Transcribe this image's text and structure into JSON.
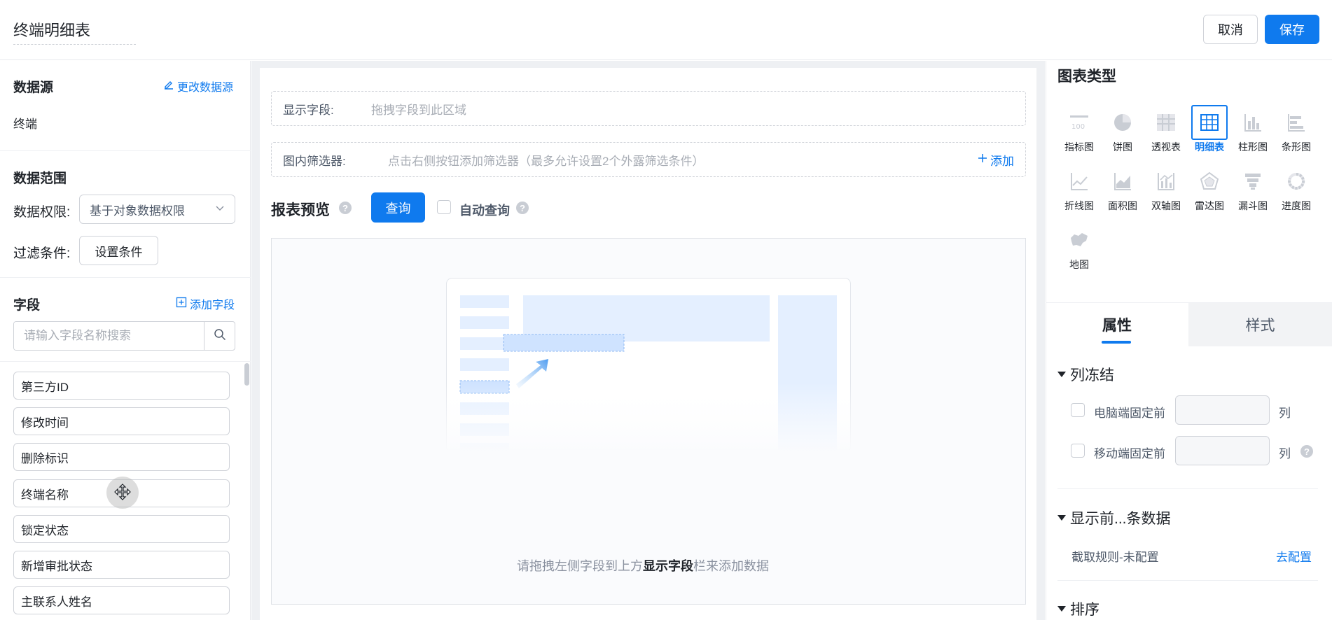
{
  "header": {
    "title": "终端明细表",
    "cancel_label": "取消",
    "save_label": "保存"
  },
  "left": {
    "datasource": {
      "title": "数据源",
      "change_link": "更改数据源",
      "value": "终端"
    },
    "data_range": {
      "title": "数据范围",
      "permission_label": "数据权限:",
      "permission_value": "基于对象数据权限",
      "filter_label": "过滤条件:",
      "filter_button": "设置条件"
    },
    "fields": {
      "title": "字段",
      "add_link": "添加字段",
      "search_placeholder": "请输入字段名称搜索",
      "items": [
        "第三方ID",
        "修改时间",
        "删除标识",
        "终端名称",
        "锁定状态",
        "新增审批状态",
        "主联系人姓名"
      ]
    }
  },
  "center": {
    "display_fields_label": "显示字段:",
    "display_fields_hint": "拖拽字段到此区域",
    "filter_label": "图内筛选器:",
    "filter_hint": "点击右侧按钮添加筛选器（最多允许设置2个外露筛选条件）",
    "filter_add": "添加",
    "preview_title": "报表预览",
    "query_button": "查询",
    "auto_query_label": "自动查询",
    "empty_hint_prefix": "请拖拽左侧字段到上方",
    "empty_hint_bold": "显示字段",
    "empty_hint_suffix": "栏来添加数据"
  },
  "right": {
    "chart_type_title": "图表类型",
    "chart_types": [
      {
        "label": "指标图",
        "icon": "metric-chart-icon"
      },
      {
        "label": "饼图",
        "icon": "pie-chart-icon"
      },
      {
        "label": "透视表",
        "icon": "pivot-table-icon"
      },
      {
        "label": "明细表",
        "icon": "detail-table-icon",
        "active": true
      },
      {
        "label": "柱形图",
        "icon": "column-chart-icon"
      },
      {
        "label": "条形图",
        "icon": "bar-chart-icon"
      },
      {
        "label": "折线图",
        "icon": "line-chart-icon"
      },
      {
        "label": "面积图",
        "icon": "area-chart-icon"
      },
      {
        "label": "双轴图",
        "icon": "dual-axis-chart-icon"
      },
      {
        "label": "雷达图",
        "icon": "radar-chart-icon"
      },
      {
        "label": "漏斗图",
        "icon": "funnel-chart-icon"
      },
      {
        "label": "进度图",
        "icon": "progress-chart-icon"
      },
      {
        "label": "地图",
        "icon": "map-chart-icon"
      }
    ],
    "tabs": {
      "attributes": "属性",
      "style": "样式"
    },
    "column_freeze": {
      "title": "列冻结",
      "pc_label": "电脑端固定前",
      "mobile_label": "移动端固定前",
      "unit": "列"
    },
    "top_n": {
      "title": "显示前...条数据",
      "rule_label": "截取规则-未配置",
      "config_link": "去配置"
    },
    "sort": {
      "title": "排序"
    }
  },
  "colors": {
    "primary": "#0f7aee",
    "border": "#d0d3d9",
    "muted": "#a8adb5"
  }
}
